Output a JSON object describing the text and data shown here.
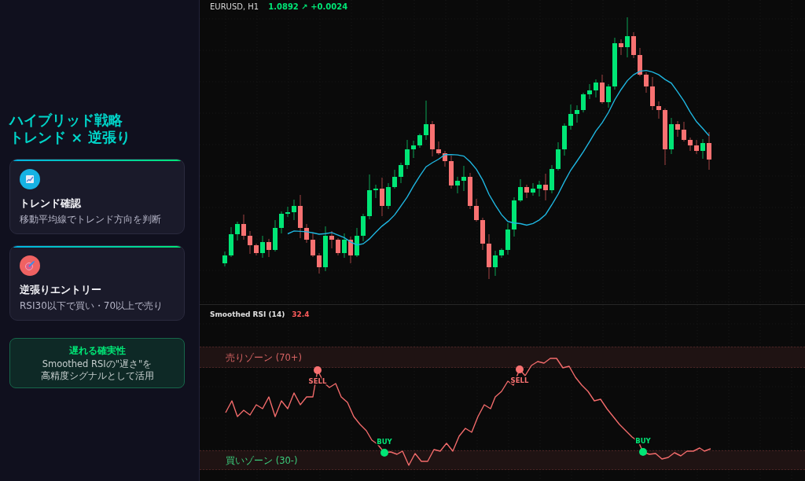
{
  "sidebar": {
    "title_lines": [
      "ハイブリッド戦略",
      "トレンド × 逆張り"
    ],
    "cards": [
      {
        "kind": "trend",
        "title": "トレンド確認",
        "description": "移動平均線でトレンド方向を判断"
      },
      {
        "kind": "entry",
        "title": "逆張りエントリー",
        "description": "RSI30以下で買い・70以上で売り"
      }
    ],
    "highlight": {
      "title": "遅れる確実性",
      "lines": [
        "Smoothed RSIの\"遅さ\"を",
        "高精度シグナルとして活用"
      ]
    }
  },
  "price_chart": {
    "symbol": "EURUSD, H1",
    "quote": "1.0892 ↗ +0.0024"
  },
  "rsi_panel": {
    "title": "Smoothed RSI (14)",
    "value": "32.4",
    "zones": [
      {
        "kind": "sell",
        "label": "売りゾーン (70+)"
      },
      {
        "kind": "buy",
        "label": "買いゾーン (30-)"
      }
    ],
    "signals": [
      {
        "kind": "sell",
        "label": "SELL"
      },
      {
        "kind": "buy",
        "label": "BUY"
      },
      {
        "kind": "sell",
        "label": "SELL"
      },
      {
        "kind": "buy",
        "label": "BUY"
      }
    ]
  }
}
